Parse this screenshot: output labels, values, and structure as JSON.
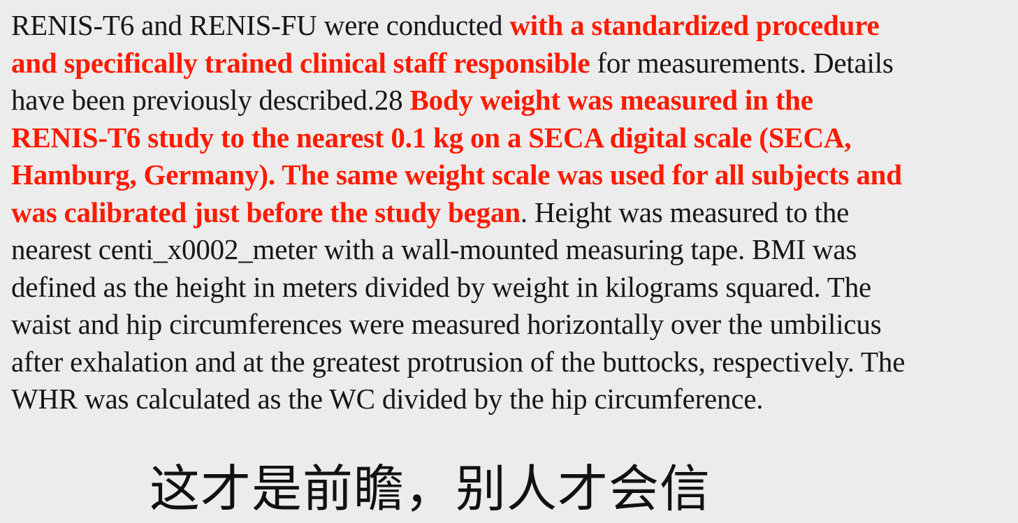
{
  "passage": {
    "lines": [
      [
        {
          "text": "RENIS-T6 and RENIS-FU were conducted ",
          "highlight": false
        },
        {
          "text": "with a standardized procedure",
          "highlight": true
        }
      ],
      [
        {
          "text": "and specifically trained clinical staff responsible",
          "highlight": true
        },
        {
          "text": " for measurements. Details",
          "highlight": false
        }
      ],
      [
        {
          "text": "have been previously described.28 ",
          "highlight": false
        },
        {
          "text": "Body weight was measured in the",
          "highlight": true
        }
      ],
      [
        {
          "text": "RENIS-T6 study to the nearest 0.1 kg on a SECA digital scale (SECA,",
          "highlight": true
        }
      ],
      [
        {
          "text": "Hamburg, Germany). The same weight scale was used for all subjects and",
          "highlight": true
        }
      ],
      [
        {
          "text": "was calibrated just before the study began",
          "highlight": true
        },
        {
          "text": ". Height was measured to the",
          "highlight": false
        }
      ],
      [
        {
          "text": "nearest centi_x0002_meter with a wall-mounted measuring tape. BMI was",
          "highlight": false
        }
      ],
      [
        {
          "text": "defined as the height in meters divided by weight in kilograms squared. The",
          "highlight": false
        }
      ],
      [
        {
          "text": "waist and hip circumferences were measured horizontally over the umbilicus",
          "highlight": false
        }
      ],
      [
        {
          "text": "after exhalation and at the greatest protrusion of the buttocks, respectively. The",
          "highlight": false
        }
      ],
      [
        {
          "text": "WHR was calculated as the WC divided by the hip circumference.",
          "highlight": false
        }
      ]
    ]
  },
  "subtitle": "这才是前瞻，别人才会信",
  "colors": {
    "background": "#ececec",
    "text": "#161616",
    "highlight": "#ff1a00"
  }
}
